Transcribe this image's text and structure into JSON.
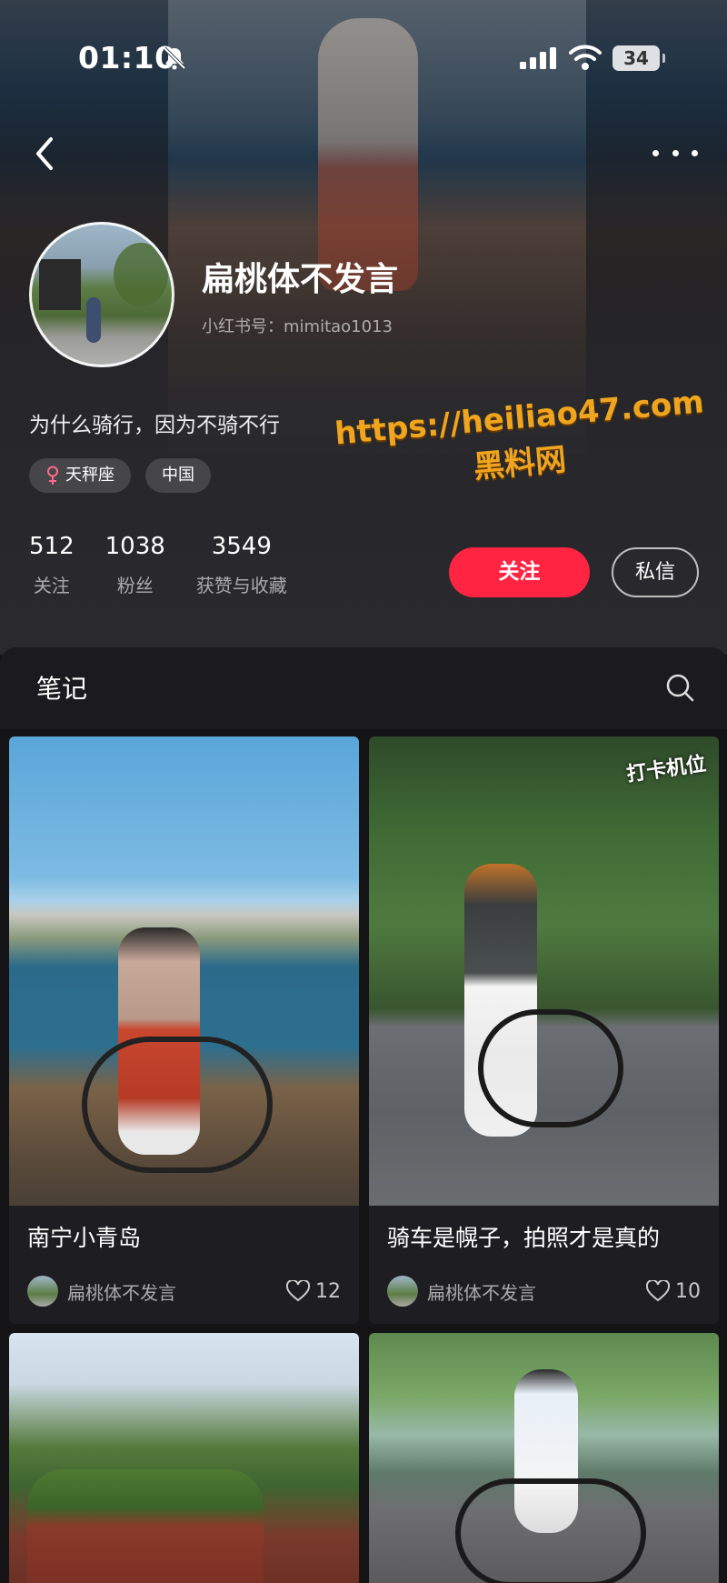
{
  "status_bar": {
    "time": "01:10",
    "battery": "34"
  },
  "profile": {
    "name": "扁桃体不发言",
    "id_text": "小红书号：mimitao1013",
    "bio": "为什么骑行，因为不骑不行",
    "tags": [
      "天秤座",
      "中国"
    ],
    "stats": [
      {
        "value": "512",
        "label": "关注"
      },
      {
        "value": "1038",
        "label": "粉丝"
      },
      {
        "value": "3549",
        "label": "获赞与收藏"
      }
    ],
    "follow_label": "关注",
    "message_label": "私信"
  },
  "watermark": {
    "url": "https://heiliao47.com",
    "name": "黑料网"
  },
  "tabs": {
    "notes_label": "笔记"
  },
  "notes": [
    {
      "title": "南宁小青岛",
      "author": "扁桃体不发言",
      "likes": "12"
    },
    {
      "title": "骑车是幌子，拍照才是真的",
      "author": "扁桃体不发言",
      "likes": "10",
      "sticker": "打卡机位"
    },
    {
      "title": "",
      "author": "",
      "likes": ""
    },
    {
      "title": "",
      "author": "",
      "likes": ""
    }
  ],
  "colors": {
    "accent": "#ff2442",
    "watermark": "#f0a51e",
    "background": "#151518"
  },
  "icons": [
    "mute-icon",
    "signal-icon",
    "wifi-icon",
    "back-icon",
    "more-icon",
    "female-icon",
    "search-icon",
    "heart-icon"
  ]
}
